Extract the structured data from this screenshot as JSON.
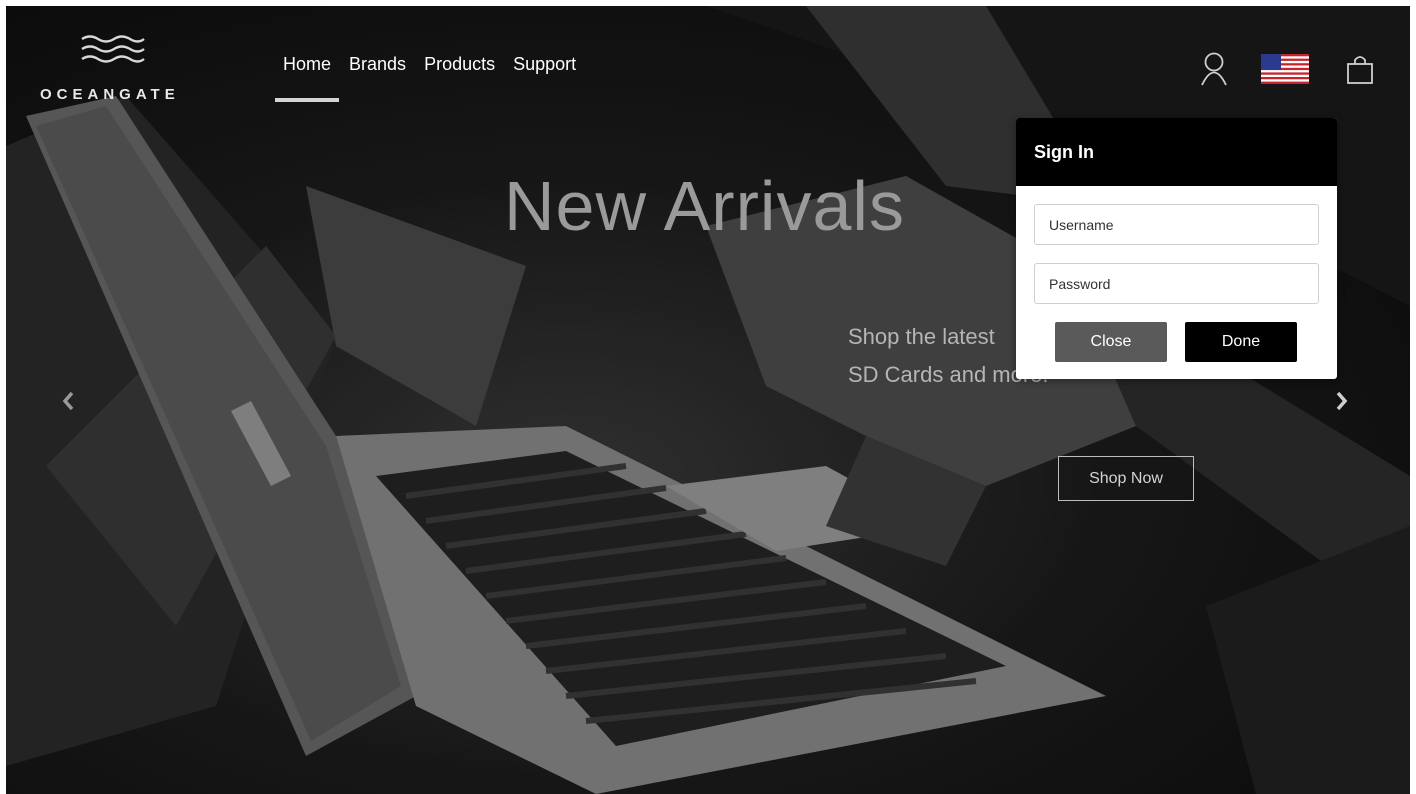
{
  "brand": {
    "logo_text": "OCEANGATE"
  },
  "nav": {
    "items": [
      {
        "label": "Home",
        "active": true
      },
      {
        "label": "Brands",
        "active": false
      },
      {
        "label": "Products",
        "active": false
      },
      {
        "label": "Support",
        "active": false
      }
    ]
  },
  "header_icons": [
    "user-icon",
    "us-flag-icon",
    "shopping-bag-icon"
  ],
  "hero": {
    "headline": "New Arrivals",
    "subtitle_line1": "Shop the latest",
    "subtitle_line2": "SD Cards and more.",
    "cta_label": "Shop Now",
    "arrows": [
      "chevron-left-icon",
      "chevron-right-icon"
    ]
  },
  "signin": {
    "title": "Sign In",
    "username_placeholder": "Username",
    "password_placeholder": "Password",
    "close_label": "Close",
    "done_label": "Done"
  },
  "colors": {
    "popup_header": "#000000",
    "close_button": "#5a5a5a",
    "done_button": "#000000",
    "headline": "#9a9a9a"
  }
}
